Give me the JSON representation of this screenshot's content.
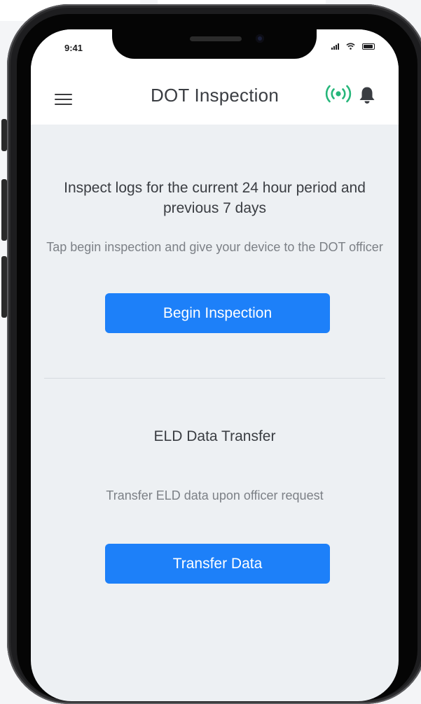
{
  "status_bar": {
    "time": "9:41"
  },
  "header": {
    "title": "DOT Inspection",
    "icons": [
      "menu-icon",
      "broadcast-icon",
      "bell-icon"
    ],
    "broadcast_color": "#26b67a"
  },
  "inspection": {
    "headline": "Inspect logs for the current 24 hour period and previous 7 days",
    "instructions": "Tap begin inspection and give your device to the DOT officer",
    "button_label": "Begin Inspection"
  },
  "transfer": {
    "title": "ELD Data Transfer",
    "description": "Transfer ELD data upon officer request",
    "button_label": "Transfer Data"
  },
  "colors": {
    "accent": "#1d80f9",
    "screen_bg": "#edf0f3",
    "text_primary": "#3a3d42",
    "text_secondary": "#7c8086"
  }
}
